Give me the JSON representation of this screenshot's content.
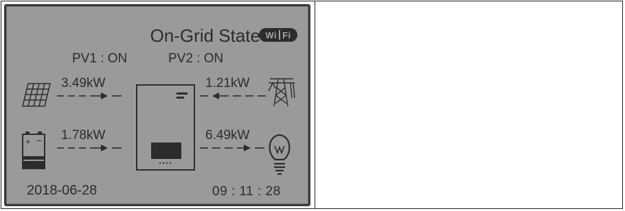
{
  "screen": {
    "title": "On-Grid State",
    "wifi_badge": {
      "left": "Wi",
      "right": "Fi"
    },
    "pv1_status": "PV1 : ON",
    "pv2_status": "PV2 : ON",
    "pv_power": "3.49kW",
    "grid_power": "1.21kW",
    "battery_power": "1.78kW",
    "load_power": "6.49kW",
    "date": "2018-06-28",
    "time": "09 : 11 : 28"
  },
  "icons": {
    "pv": "solar-panel-icon",
    "grid": "power-tower-icon",
    "battery": "battery-icon",
    "load": "light-bulb-icon",
    "inverter": "inverter-icon"
  },
  "colors": {
    "lcd_background": "#9a9a9a",
    "lcd_foreground": "#2c2c2c",
    "frame": "#3a3a3a"
  }
}
